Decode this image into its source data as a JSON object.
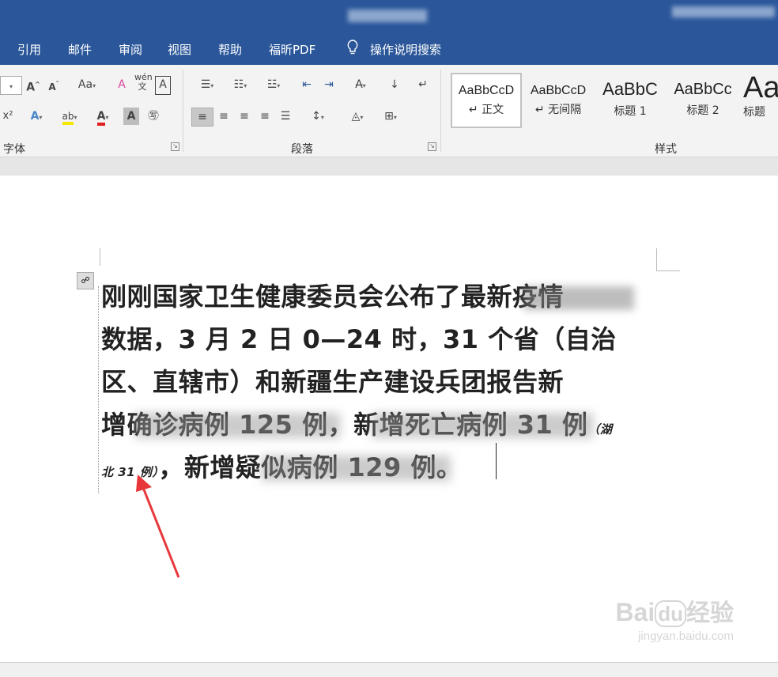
{
  "tabs": [
    "引用",
    "邮件",
    "审阅",
    "视图",
    "帮助",
    "福昕PDF",
    "操作说明搜索"
  ],
  "groups": {
    "font": "字体",
    "paragraph": "段落",
    "styles": "样式"
  },
  "styles": [
    {
      "sample": "AaBbCcD",
      "name": "↵ 正文"
    },
    {
      "sample": "AaBbCcD",
      "name": "↵ 无间隔"
    },
    {
      "sample": "AaBbC",
      "name": "标题 1"
    },
    {
      "sample": "AaBbCc",
      "name": "标题 2"
    },
    {
      "sample": "Aa",
      "name": "标题"
    }
  ],
  "document": {
    "line1": "刚刚国家卫生健康委员会公布了最新疫情",
    "line2": "数据，3 月 2 日 0—24 时，31 个省（自治",
    "line3": "区、直辖市）和新疆生产建设兵团报告新",
    "line4": "增确诊病例 125 例，新增死亡病例 31 例",
    "line4_note": "（湖",
    "line5_note": "北 31 例）",
    "line5": "，新增疑似病例 129 例。"
  },
  "watermark": {
    "brand": "Bai",
    "paw": "du",
    "product": "经验",
    "url": "jingyan.baidu.com"
  },
  "colors": {
    "title_bar": "#2b579a",
    "arrow": "#e8373a"
  }
}
